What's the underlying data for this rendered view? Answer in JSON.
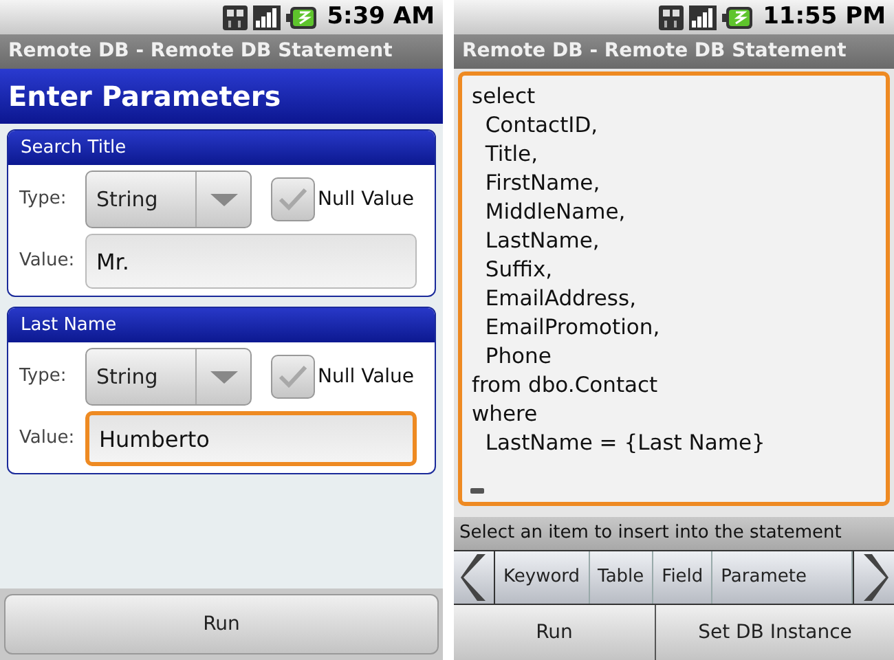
{
  "screens": [
    {
      "status_bar": {
        "time": "5:39 AM"
      },
      "title": "Remote DB - Remote DB Statement",
      "header": "Enter Parameters",
      "parameters": [
        {
          "name": "Search Title",
          "type_label": "Type:",
          "type": "String",
          "null_label": "Null Value",
          "null_checked": false,
          "value_label": "Value:",
          "value": "Mr.",
          "focused": false
        },
        {
          "name": "Last Name",
          "type_label": "Type:",
          "type": "String",
          "null_label": "Null Value",
          "null_checked": false,
          "value_label": "Value:",
          "value": "Humberto",
          "focused": true
        }
      ],
      "buttons": [
        "Run"
      ]
    },
    {
      "status_bar": {
        "time": "11:55 PM"
      },
      "title": "Remote DB - Remote DB Statement",
      "statement": [
        "select",
        "  ContactID,",
        "  Title,",
        "  FirstName,",
        "  MiddleName,",
        "  LastName,",
        "  Suffix,",
        "  EmailAddress,",
        "  EmailPromotion,",
        "  Phone",
        "from dbo.Contact",
        "where",
        "  LastName = {Last Name}"
      ],
      "hint": "Select an item to insert into the statement",
      "insert_tabs": [
        "Keyword",
        "Table",
        "Field",
        "Paramete"
      ],
      "buttons": [
        "Run",
        "Set DB Instance"
      ]
    }
  ]
}
